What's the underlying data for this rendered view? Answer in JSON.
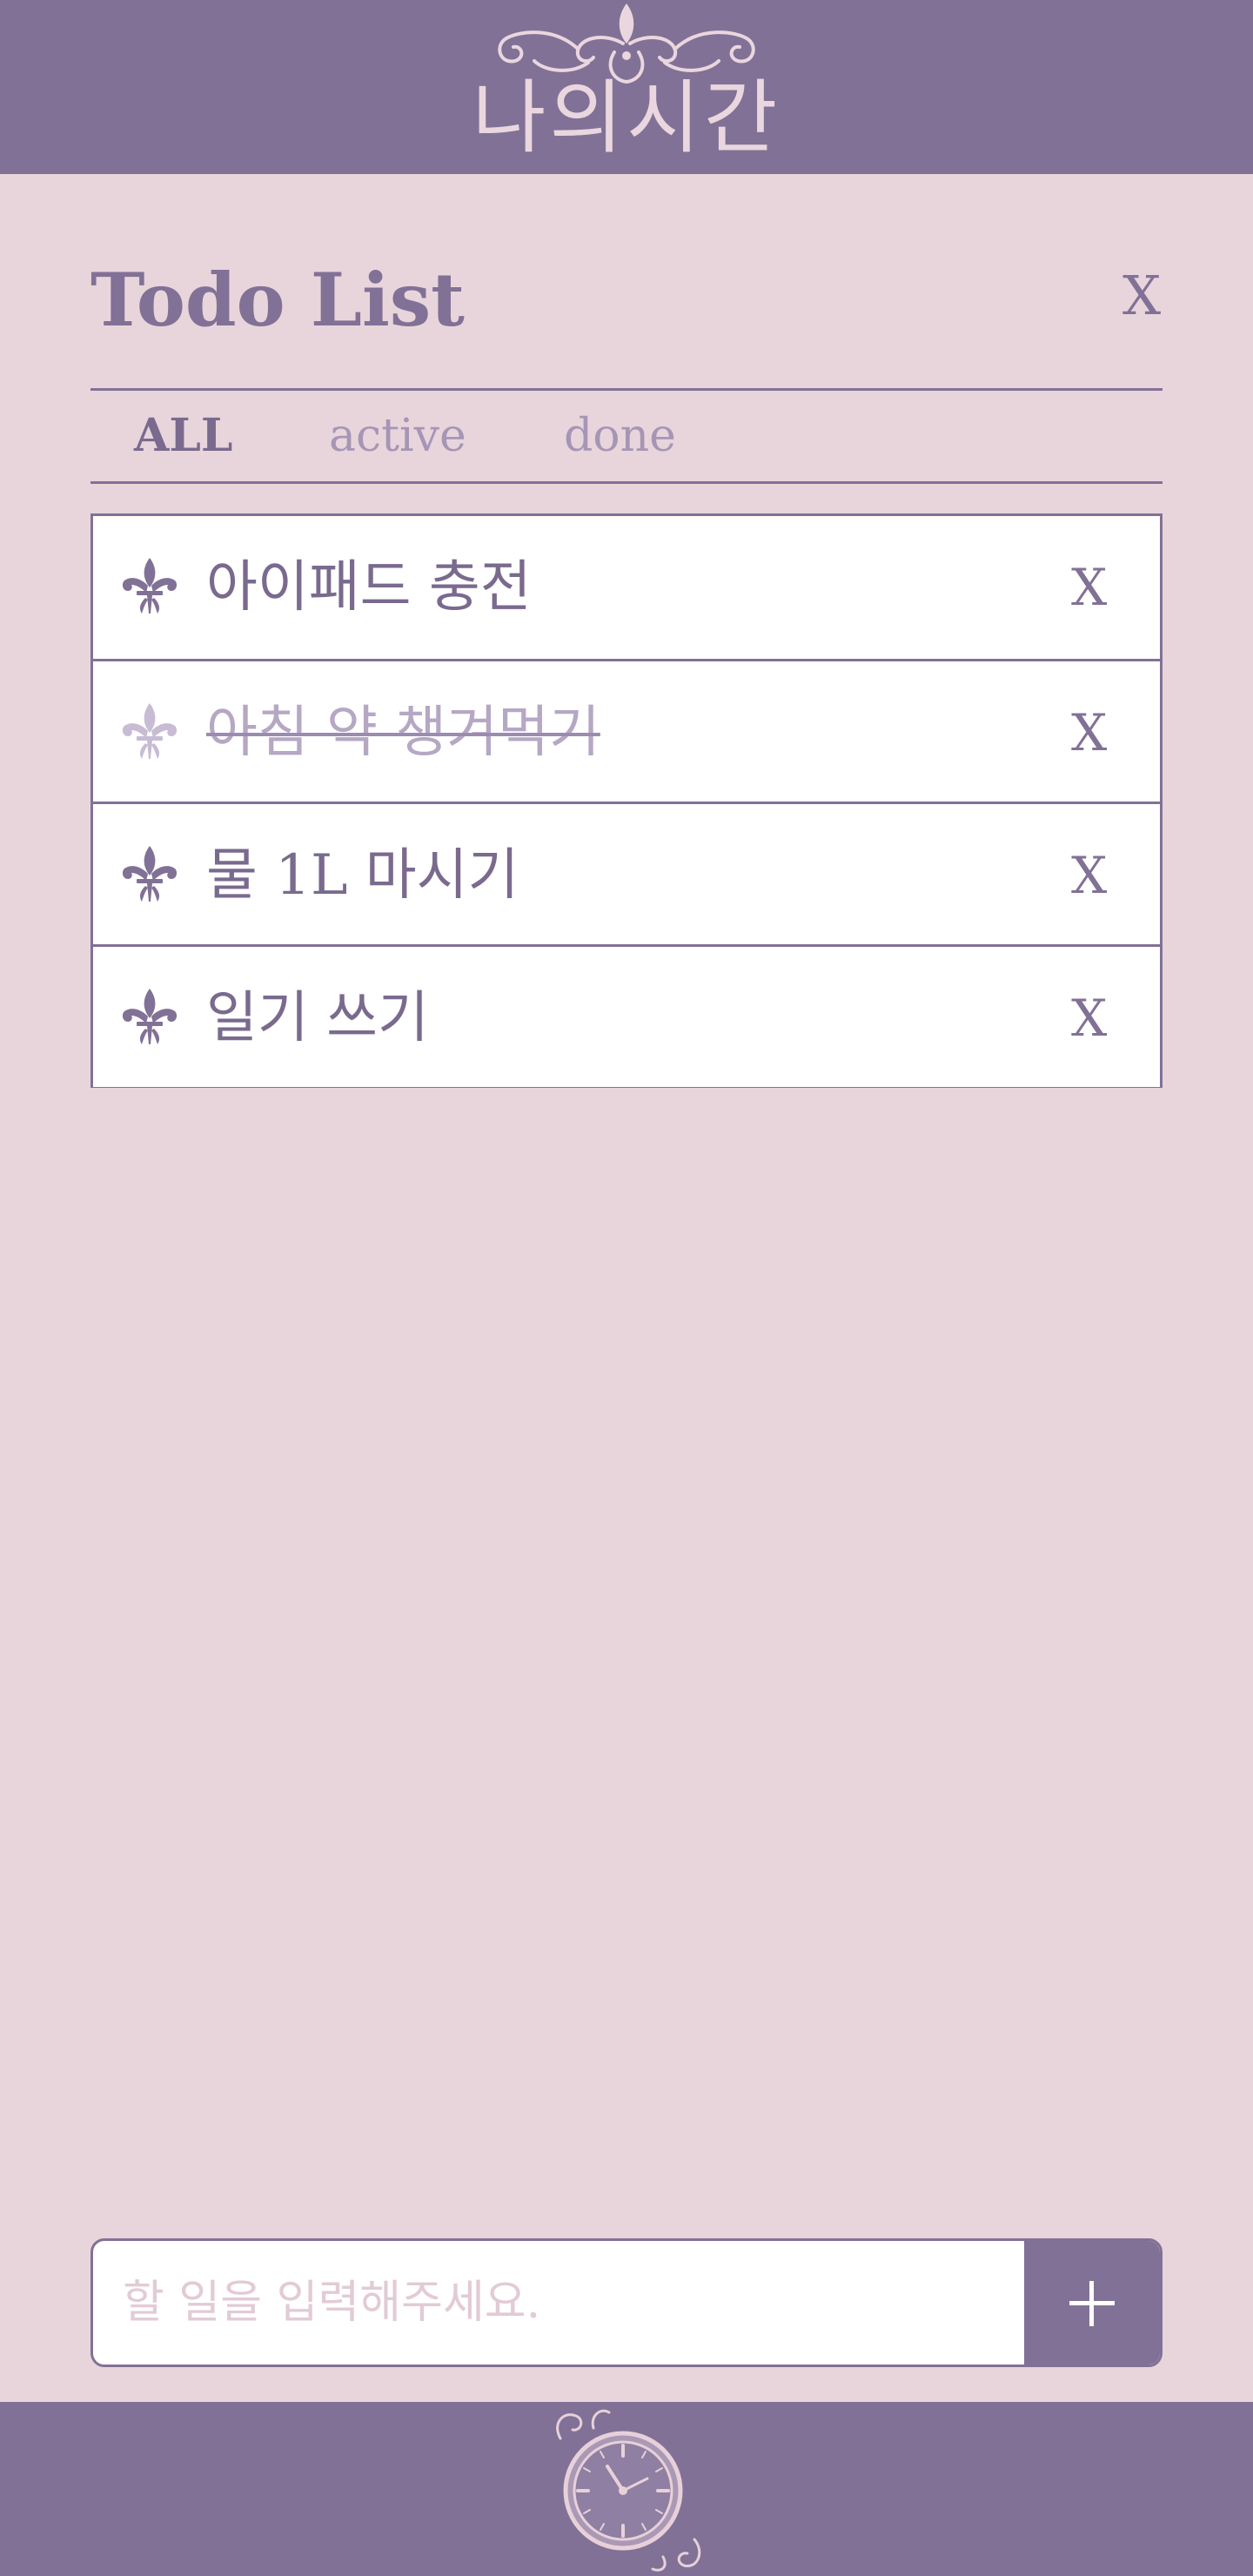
{
  "header": {
    "title": "나의시간",
    "logo_icon": "fleur-de-lis-ornament-icon"
  },
  "panel": {
    "title": "Todo List",
    "close_label": "X"
  },
  "filters": [
    {
      "label": "ALL",
      "selected": true
    },
    {
      "label": "active",
      "selected": false
    },
    {
      "label": "done",
      "selected": false
    }
  ],
  "todos": [
    {
      "text": "아이패드 충전",
      "done": false,
      "delete_label": "X"
    },
    {
      "text": "아침 약 챙겨먹기",
      "done": true,
      "delete_label": "X"
    },
    {
      "text": "물 1L 마시기",
      "done": false,
      "delete_label": "X"
    },
    {
      "text": "일기 쓰기",
      "done": false,
      "delete_label": "X"
    }
  ],
  "input": {
    "placeholder": "할 일을 입력해주세요.",
    "value": "",
    "add_icon": "plus-icon"
  },
  "footer": {
    "icon": "ornate-clock-icon"
  },
  "colors": {
    "primary": "#827196",
    "background": "#e8d5dc",
    "accent_light": "#ead6de",
    "done_text": "#b6a8c4"
  }
}
